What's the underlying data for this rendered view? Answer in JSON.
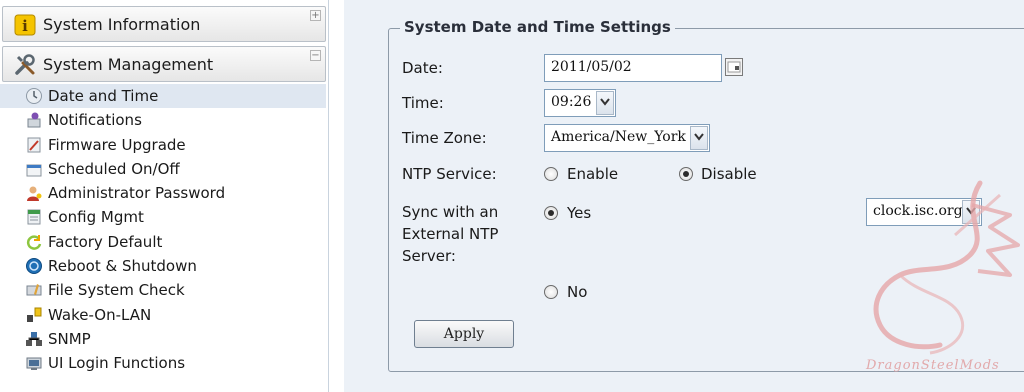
{
  "sidebar": {
    "system_information": {
      "label": "System Information",
      "toggle": "+"
    },
    "system_management": {
      "label": "System Management",
      "toggle": "−"
    },
    "items": [
      {
        "label": "Date and Time",
        "selected": true,
        "icon": "clock-icon"
      },
      {
        "label": "Notifications",
        "icon": "notification-icon"
      },
      {
        "label": "Firmware Upgrade",
        "icon": "firmware-icon"
      },
      {
        "label": "Scheduled On/Off",
        "icon": "schedule-icon"
      },
      {
        "label": "Administrator Password",
        "icon": "admin-user-icon"
      },
      {
        "label": "Config Mgmt",
        "icon": "config-icon"
      },
      {
        "label": "Factory Default",
        "icon": "factory-reset-icon"
      },
      {
        "label": "Reboot & Shutdown",
        "icon": "power-icon"
      },
      {
        "label": "File System Check",
        "icon": "disk-check-icon"
      },
      {
        "label": "Wake-On-LAN",
        "icon": "wol-icon"
      },
      {
        "label": "SNMP",
        "icon": "snmp-icon"
      },
      {
        "label": "UI Login Functions",
        "icon": "login-icon"
      }
    ]
  },
  "main": {
    "legend": "System Date and Time Settings",
    "date": {
      "label": "Date:",
      "value": "2011/05/02"
    },
    "time": {
      "label": "Time:",
      "value": "09:26"
    },
    "timezone": {
      "label": "Time Zone:",
      "value": "America/New_York"
    },
    "ntp_service": {
      "label": "NTP Service:",
      "enable": "Enable",
      "disable": "Disable",
      "selected": "disable"
    },
    "sync": {
      "label_line1": "Sync with an",
      "label_line2": "External NTP",
      "label_line3": "Server:",
      "yes": "Yes",
      "no": "No",
      "selected": "yes",
      "server": "clock.isc.org"
    },
    "apply": "Apply"
  },
  "watermark": {
    "text": "DragonSteelMods"
  },
  "colors": {
    "selected_bg": "#dfe7f1",
    "main_bg": "#ecf1f7",
    "watermark": "#e2a9ab"
  }
}
